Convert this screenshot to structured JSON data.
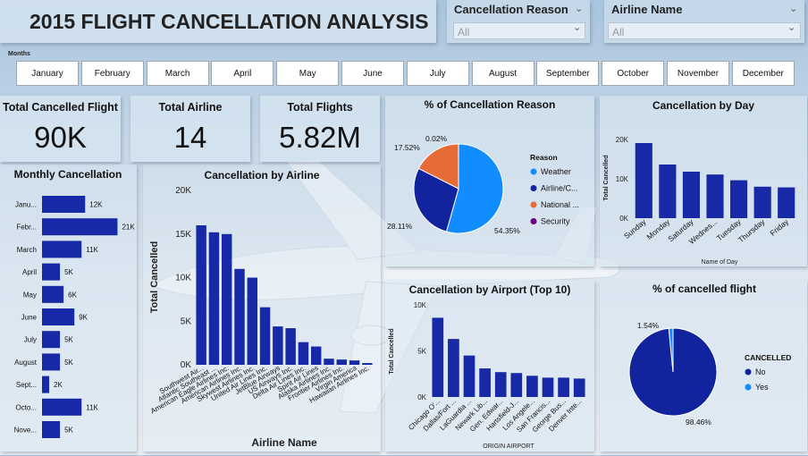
{
  "header": {
    "title": "2015 FLIGHT CANCELLATION ANALYSIS"
  },
  "slicers": [
    {
      "label": "Cancellation Reason",
      "value": "All"
    },
    {
      "label": "Airline Name",
      "value": "All"
    }
  ],
  "months_label": "Months",
  "months": [
    "January",
    "February",
    "March",
    "April",
    "May",
    "June",
    "July",
    "August",
    "September",
    "October",
    "November",
    "December"
  ],
  "kpis": [
    {
      "title": "Total Cancelled Flight",
      "value": "90K"
    },
    {
      "title": "Total Airline",
      "value": "14"
    },
    {
      "title": "Total Flights",
      "value": "5.82M"
    }
  ],
  "colors": {
    "bar": "#1729a6",
    "weather": "#118dff",
    "airline": "#12239e",
    "national": "#e66c37",
    "security": "#6b007b",
    "yes": "#118dff",
    "no": "#12239e"
  },
  "chart_data": [
    {
      "id": "monthly",
      "type": "bar",
      "orientation": "horizontal",
      "title": "Monthly Cancellation",
      "categories": [
        "Janu...",
        "Febr...",
        "March",
        "April",
        "May",
        "June",
        "July",
        "August",
        "Sept...",
        "Octo...",
        "Nove..."
      ],
      "values": [
        12,
        21,
        11,
        5,
        6,
        9,
        5,
        5,
        2,
        11,
        5
      ],
      "labels": [
        "12K",
        "21K",
        "11K",
        "5K",
        "6K",
        "9K",
        "5K",
        "5K",
        "2K",
        "11K",
        "5K"
      ],
      "xlim": [
        0,
        24
      ]
    },
    {
      "id": "airline",
      "type": "bar",
      "title": "Cancellation by Airline",
      "xlabel": "Airline Name",
      "ylabel": "Total Cancelled",
      "categories": [
        "Southwest Air...",
        "Atlantic Southeast ...",
        "American Eagle Airlines Inc.",
        "American Airlines Inc.",
        "Skywest Airlines Inc.",
        "United Air Lines Inc.",
        "JetBlue Airways",
        "US Airways Inc.",
        "Delta Air Lines Inc.",
        "Spirit Air Lines",
        "Alaska Airlines Inc.",
        "Frontier Airlines Inc.",
        "Virgin America",
        "Hawaiian Airlines Inc."
      ],
      "values": [
        16.0,
        15.2,
        15.0,
        11.0,
        10.0,
        6.6,
        4.4,
        4.2,
        2.6,
        2.1,
        0.7,
        0.6,
        0.5,
        0.2
      ],
      "ylim": [
        0,
        20
      ],
      "yticks": [
        "0K",
        "5K",
        "10K",
        "15K",
        "20K"
      ]
    },
    {
      "id": "reason",
      "type": "pie",
      "title": "% of Cancellation Reason",
      "legend_title": "Reason",
      "legend": [
        "Weather",
        "Airline/C...",
        "National ...",
        "Security"
      ],
      "values": [
        54.35,
        28.11,
        17.52,
        0.02
      ],
      "labels": [
        "54.35%",
        "28.11%",
        "17.52%",
        "0.02%"
      ]
    },
    {
      "id": "day",
      "type": "bar",
      "title": "Cancellation by Day",
      "xlabel": "Name of Day",
      "ylabel": "Total Cancelled",
      "categories": [
        "Sunday",
        "Monday",
        "Saturday",
        "Wednes...",
        "Tuesday",
        "Thursday",
        "Friday"
      ],
      "values": [
        21.0,
        15.0,
        13.0,
        12.2,
        10.6,
        8.8,
        8.6
      ],
      "ylim": [
        0,
        22
      ],
      "yticks": [
        "0K",
        "10K",
        "20K"
      ]
    },
    {
      "id": "airport",
      "type": "bar",
      "title": "Cancellation by Airport (Top 10)",
      "xlabel": "ORIGIN AIRPORT",
      "ylabel": "Total Cancelled",
      "categories": [
        "Chicago O'...",
        "Dallas/Fort ...",
        "LaGuardia ...",
        "Newark Lib...",
        "Gen. Edwar...",
        "Hartsfield-J...",
        "Los Angele...",
        "San Francis...",
        "George Bus...",
        "Denver Inte..."
      ],
      "values": [
        8.6,
        6.3,
        4.5,
        3.1,
        2.7,
        2.6,
        2.3,
        2.1,
        2.1,
        2.0
      ],
      "ylim": [
        0,
        10
      ],
      "yticks": [
        "0K",
        "5K",
        "10K"
      ]
    },
    {
      "id": "cancelled",
      "type": "pie",
      "title": "% of cancelled flight",
      "legend_title": "CANCELLED",
      "legend": [
        "No",
        "Yes"
      ],
      "values": [
        98.46,
        1.54
      ],
      "labels": [
        "98.46%",
        "1.54%"
      ]
    }
  ]
}
